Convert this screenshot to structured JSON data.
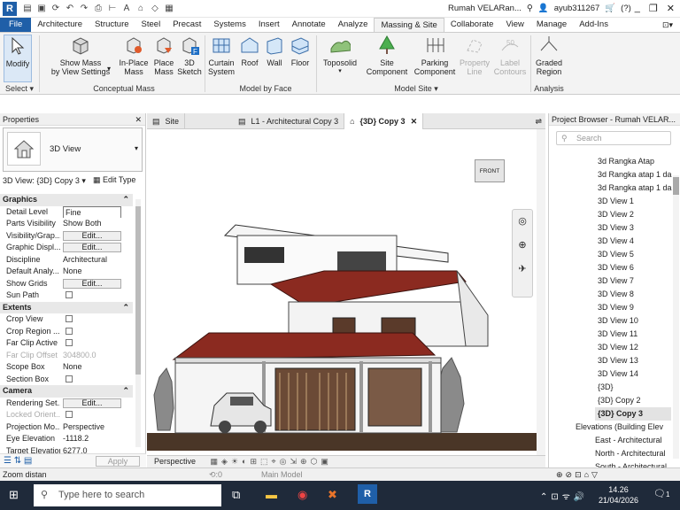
{
  "titlebar": {
    "title": "Rumah VELARan...",
    "username": "ayub311267",
    "help": "?"
  },
  "tabs": [
    "File",
    "Architecture",
    "Structure",
    "Steel",
    "Precast",
    "Systems",
    "Insert",
    "Annotate",
    "Analyze",
    "Massing & Site",
    "Collaborate",
    "View",
    "Manage",
    "Add-Ins"
  ],
  "ribbon": {
    "modify": "Modify",
    "select": "Select",
    "show_mass": "Show Mass\nby View Settings",
    "inplace_mass": "In-Place\nMass",
    "place_mass": "Place\nMass",
    "sketch_3d": "3D\nSketch",
    "conceptual_mass": "Conceptual Mass",
    "curtain_system": "Curtain\nSystem",
    "roof": "Roof",
    "wall": "Wall",
    "floor": "Floor",
    "model_by_face": "Model by Face",
    "toposolid": "Toposolid",
    "site_component": "Site\nComponent",
    "parking_component": "Parking\nComponent",
    "property_line": "Property\nLine",
    "label_contours": "Label\nContours",
    "model_site": "Model Site",
    "graded_region": "Graded\nRegion",
    "analysis": "Analysis"
  },
  "properties": {
    "title": "Properties",
    "type_name": "3D View",
    "instance": "3D View: {3D} Copy 3",
    "edit_type": "Edit Type",
    "rows": [
      {
        "k": "Graphics",
        "sec": true
      },
      {
        "k": "Detail Level",
        "v": "Fine",
        "input": true
      },
      {
        "k": "Parts Visibility",
        "v": "Show Both"
      },
      {
        "k": "Visibility/Grap...",
        "v": "Edit...",
        "btn": true
      },
      {
        "k": "Graphic Displ...",
        "v": "Edit...",
        "btn": true
      },
      {
        "k": "Discipline",
        "v": "Architectural"
      },
      {
        "k": "Default Analy...",
        "v": "None"
      },
      {
        "k": "Show Grids",
        "v": "Edit...",
        "btn": true
      },
      {
        "k": "Sun Path",
        "chk": true
      },
      {
        "k": "Extents",
        "sec": true
      },
      {
        "k": "Crop View",
        "chk": true
      },
      {
        "k": "Crop Region ...",
        "chk": true
      },
      {
        "k": "Far Clip Active",
        "chk": true
      },
      {
        "k": "Far Clip Offset",
        "v": "304800.0",
        "dim": true
      },
      {
        "k": "Scope Box",
        "v": "None"
      },
      {
        "k": "Section Box",
        "chk": true
      },
      {
        "k": "Camera",
        "sec": true
      },
      {
        "k": "Rendering Set...",
        "v": "Edit...",
        "btn": true
      },
      {
        "k": "Locked Orient...",
        "chk": true,
        "dim": true
      },
      {
        "k": "Projection Mo...",
        "v": "Perspective"
      },
      {
        "k": "Eye Elevation",
        "v": "-1118.2"
      },
      {
        "k": "Target Elevation",
        "v": "6277.0"
      }
    ],
    "apply": "Apply"
  },
  "view_tabs": [
    {
      "label": "Site"
    },
    {
      "label": "L1 - Architectural Copy 3"
    },
    {
      "label": "{3D} Copy 3",
      "active": true
    }
  ],
  "viewcube_label": "FRONT",
  "view_bar": "Perspective",
  "browser": {
    "title": "Project Browser - Rumah VELAR...",
    "search": "Search",
    "items": [
      "3d Rangka Atap",
      "3d Rangka atap 1 da",
      "3d Rangka atap 1 da",
      "3D View 1",
      "3D View 2",
      "3D View 3",
      "3D View 4",
      "3D View 5",
      "3D View 6",
      "3D View 7",
      "3D View 8",
      "3D View 9",
      "3D View 10",
      "3D View 11",
      "3D View 12",
      "3D View 13",
      "3D View 14",
      "{3D}",
      "{3D} Copy 2",
      "{3D} Copy 3"
    ],
    "elevations": "Elevations (Building Elev",
    "elev_items": [
      "East - Architectural",
      "North - Architectural",
      "South - Architectural"
    ]
  },
  "status": {
    "left": "Zoom distan",
    "coord": ":0",
    "model": "Main Model"
  },
  "taskbar": {
    "search": "Type here to search",
    "time": "14.26",
    "date": "21/04/2026",
    "notif": "1"
  }
}
